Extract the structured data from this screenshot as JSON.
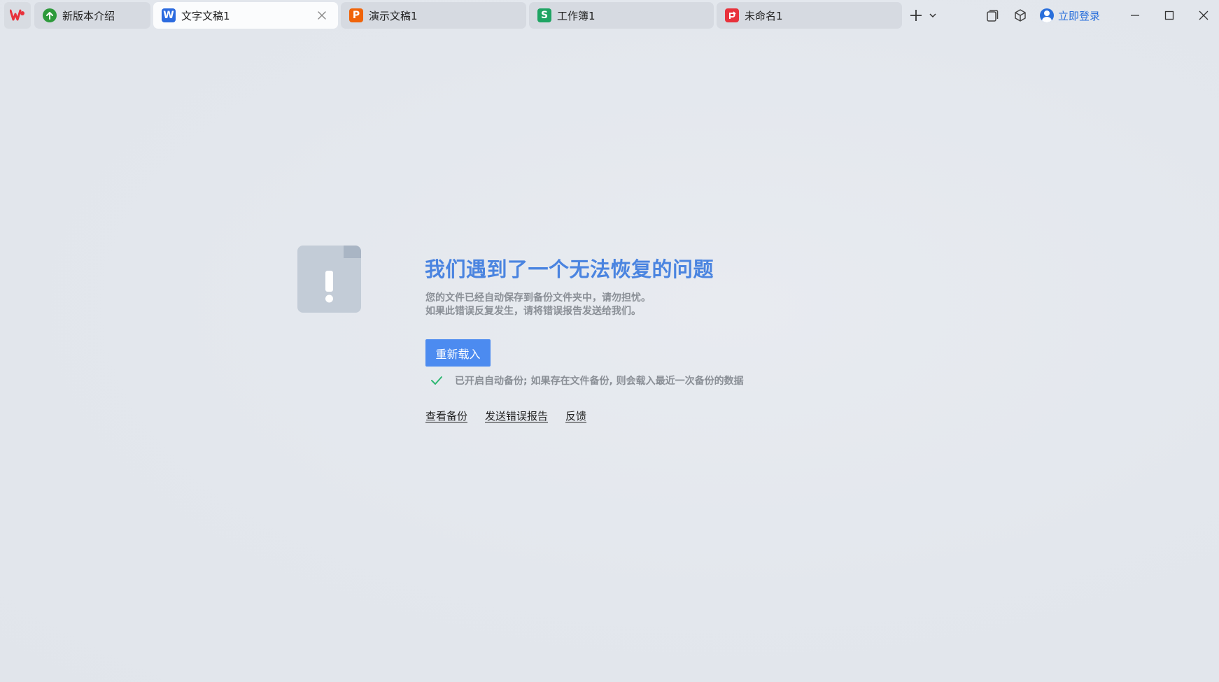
{
  "tabs": [
    {
      "label": "新版本介绍",
      "icon": "upgrade-icon",
      "active": false
    },
    {
      "label": "文字文稿1",
      "icon": "writer-doc-icon",
      "active": true
    },
    {
      "label": "演示文稿1",
      "icon": "presentation-icon",
      "active": false
    },
    {
      "label": "工作簿1",
      "icon": "spreadsheet-icon",
      "active": false
    },
    {
      "label": "未命名1",
      "icon": "pdf-icon",
      "active": false
    }
  ],
  "titlebar": {
    "login_label": "立即登录"
  },
  "error": {
    "title": "我们遇到了一个无法恢复的问题",
    "desc_line1": "您的文件已经自动保存到备份文件夹中，请勿担忧。",
    "desc_line2": "如果此错误反复发生，请将错误报告发送给我们。",
    "reload_label": "重新载入",
    "backup_note": "已开启自动备份; 如果存在文件备份, 则会载入最近一次备份的数据"
  },
  "links": {
    "view_backup": "查看备份",
    "send_report": "发送错误报告",
    "feedback": "反馈"
  },
  "colors": {
    "accent": "#4c8bf0",
    "title_blue": "#4a84e0",
    "writer_blue": "#2c6bdf",
    "presentation_orange": "#f0640a",
    "spreadsheet_green": "#1fa463",
    "pdf_red": "#e8323c",
    "upgrade_green": "#2e9a3c"
  }
}
